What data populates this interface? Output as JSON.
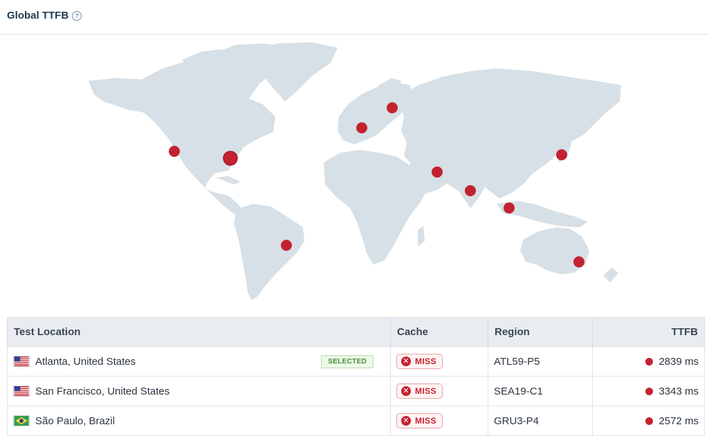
{
  "header": {
    "title": "Global TTFB",
    "help_glyph": "?"
  },
  "map": {
    "land_color": "#d6e0e6",
    "marker_color": "#c4222f",
    "markers": [
      {
        "city": "Atlanta",
        "selected": true
      },
      {
        "city": "San Francisco"
      },
      {
        "city": "São Paulo"
      },
      {
        "city": "London"
      },
      {
        "city": "Stockholm"
      },
      {
        "city": "Dubai"
      },
      {
        "city": "Bangalore"
      },
      {
        "city": "Singapore"
      },
      {
        "city": "Tokyo"
      },
      {
        "city": "Sydney"
      }
    ]
  },
  "table": {
    "columns": {
      "location": "Test Location",
      "cache": "Cache",
      "region": "Region",
      "ttfb": "TTFB"
    },
    "rows": [
      {
        "flag": "us-flag",
        "location": "Atlanta, United States",
        "badge": "SELECTED",
        "cache": "MISS",
        "region": "ATL59-P5",
        "ttfb": "2839 ms"
      },
      {
        "flag": "us-flag",
        "location": "San Francisco, United States",
        "badge": "",
        "cache": "MISS",
        "region": "SEA19-C1",
        "ttfb": "3343 ms"
      },
      {
        "flag": "br-flag",
        "location": "São Paulo, Brazil",
        "badge": "",
        "cache": "MISS",
        "region": "GRU3-P4",
        "ttfb": "2572 ms"
      }
    ]
  },
  "colors": {
    "miss": "#c4222f",
    "selected_badge": "#3f8f3a",
    "header_bg": "#e9ecf0"
  }
}
